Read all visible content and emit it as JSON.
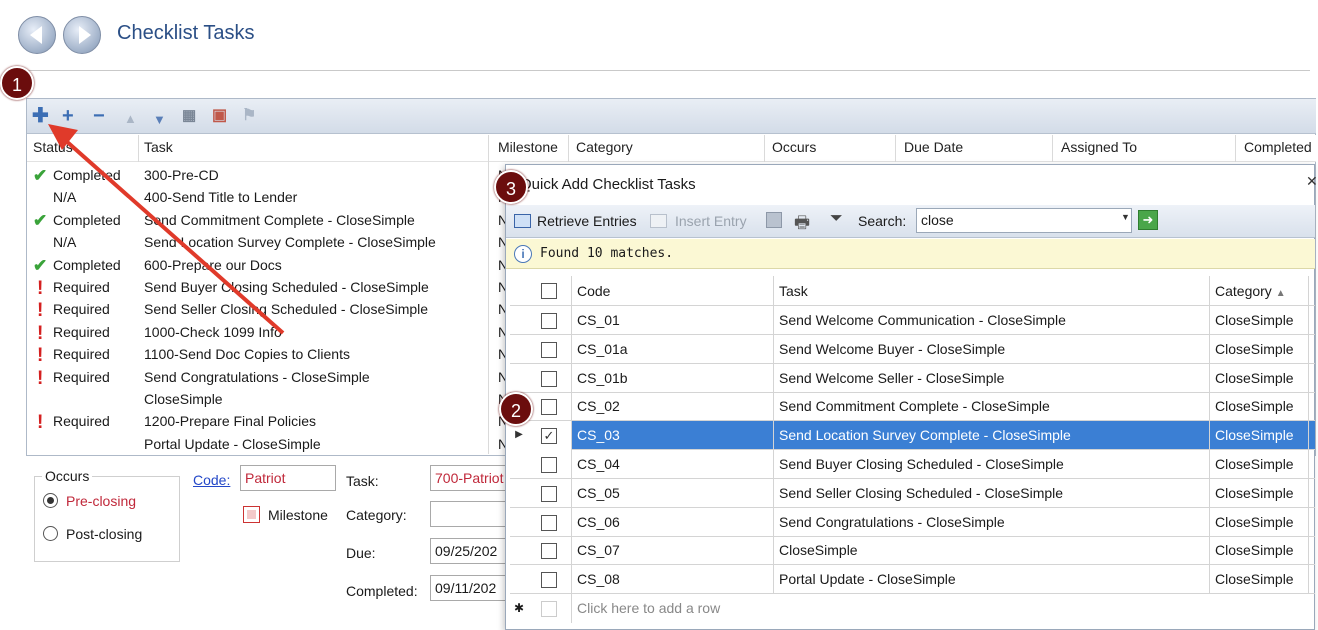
{
  "header": {
    "title": "Checklist Tasks"
  },
  "main_table": {
    "columns": [
      "Status",
      "Task",
      "Milestone",
      "Category",
      "Occurs",
      "Due Date",
      "Assigned To",
      "Completed"
    ],
    "rows": [
      {
        "status": "Completed",
        "icon": "check",
        "task": "300-Pre-CD"
      },
      {
        "status": "N/A",
        "icon": "",
        "task": "400-Send Title to Lender"
      },
      {
        "status": "Completed",
        "icon": "check",
        "task": "Send Commitment Complete - CloseSimple"
      },
      {
        "status": "N/A",
        "icon": "",
        "task": "Send Location Survey Complete - CloseSimple"
      },
      {
        "status": "Completed",
        "icon": "check",
        "task": "600-Prepare our Docs"
      },
      {
        "status": "Required",
        "icon": "exclamation",
        "task": "Send Buyer Closing Scheduled - CloseSimple"
      },
      {
        "status": "Required",
        "icon": "exclamation",
        "task": "Send Seller Closing Scheduled - CloseSimple"
      },
      {
        "status": "Required",
        "icon": "exclamation",
        "task": "1000-Check 1099 Info"
      },
      {
        "status": "Required",
        "icon": "exclamation",
        "task": "1100-Send Doc Copies to Clients"
      },
      {
        "status": "Required",
        "icon": "exclamation",
        "task": "Send Congratulations - CloseSimple"
      },
      {
        "status": "",
        "icon": "",
        "task": "CloseSimple"
      },
      {
        "status": "Required",
        "icon": "exclamation",
        "task": "1200-Prepare Final Policies"
      },
      {
        "status": "",
        "icon": "",
        "task": "Portal Update - CloseSimple"
      }
    ],
    "milestone_truncated": "N"
  },
  "form": {
    "occurs_legend": "Occurs",
    "pre_closing": "Pre-closing",
    "post_closing": "Post-closing",
    "code_label": "Code:",
    "code_value": "Patriot",
    "milestone_label": "Milestone",
    "task_label": "Task:",
    "task_value": "700-Patriot",
    "category_label": "Category:",
    "category_value": "",
    "due_label": "Due:",
    "due_value": "09/25/202",
    "completed_label": "Completed:",
    "completed_value": "09/11/202"
  },
  "dialog": {
    "title": "Quick Add Checklist Tasks",
    "toolbar": {
      "retrieve": "Retrieve Entries",
      "insert": "Insert Entry",
      "search_label": "Search:",
      "search_value": "close"
    },
    "info": "Found 10 matches.",
    "columns": {
      "code": "Code",
      "task": "Task",
      "category": "Category"
    },
    "rows": [
      {
        "code": "CS_01",
        "task": "Send Welcome Communication - CloseSimple",
        "category": "CloseSimple",
        "checked": false
      },
      {
        "code": "CS_01a",
        "task": "Send Welcome Buyer - CloseSimple",
        "category": "CloseSimple",
        "checked": false
      },
      {
        "code": "CS_01b",
        "task": "Send Welcome Seller - CloseSimple",
        "category": "CloseSimple",
        "checked": false
      },
      {
        "code": "CS_02",
        "task": "Send Commitment Complete - CloseSimple",
        "category": "CloseSimple",
        "checked": false
      },
      {
        "code": "CS_03",
        "task": "Send Location Survey Complete - CloseSimple",
        "category": "CloseSimple",
        "checked": true
      },
      {
        "code": "CS_04",
        "task": "Send Buyer Closing Scheduled - CloseSimple",
        "category": "CloseSimple",
        "checked": false
      },
      {
        "code": "CS_05",
        "task": "Send Seller Closing Scheduled - CloseSimple",
        "category": "CloseSimple",
        "checked": false
      },
      {
        "code": "CS_06",
        "task": "Send Congratulations - CloseSimple",
        "category": "CloseSimple",
        "checked": false
      },
      {
        "code": "CS_07",
        "task": "CloseSimple",
        "category": "CloseSimple",
        "checked": false
      },
      {
        "code": "CS_08",
        "task": "Portal Update - CloseSimple",
        "category": "CloseSimple",
        "checked": false
      }
    ],
    "new_row": "Click here to add a row"
  },
  "callouts": [
    "1",
    "2",
    "3"
  ],
  "colors": {
    "title": "#2b4f86",
    "selection": "#3b7fd4",
    "callout": "#6b0d0d",
    "arrow": "#e03a2a",
    "required": "#d42020",
    "check": "#3aa33a"
  }
}
